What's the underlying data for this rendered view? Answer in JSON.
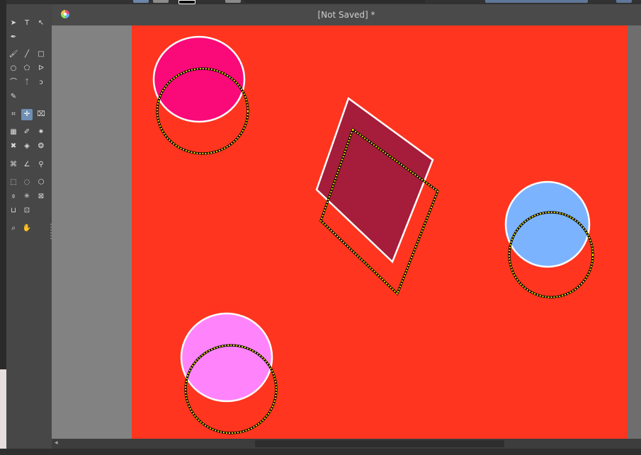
{
  "document": {
    "title": "[Not Saved]  *"
  },
  "colors": {
    "canvas_background": "#ff3520",
    "circle_top_left": "#fa0a78",
    "circle_right": "#7cb3ff",
    "circle_bottom_left": "#ff84fb",
    "diamond": "#a51d3a",
    "selection_marquee": "#ffee00",
    "active_tool": "#6f8fb3"
  },
  "toolbox": {
    "tools": [
      {
        "icon": "select-shapes-icon",
        "glyph": "➤"
      },
      {
        "icon": "text-tool-icon",
        "glyph": "T"
      },
      {
        "icon": "edit-shapes-icon",
        "glyph": "↖"
      },
      {
        "icon": "calligraphy-icon",
        "glyph": "✒"
      },
      {
        "icon": "freehand-brush-icon",
        "glyph": "🖌"
      },
      {
        "icon": "line-tool-icon",
        "glyph": "╱"
      },
      {
        "icon": "rectangle-tool-icon",
        "glyph": "□"
      },
      {
        "icon": "ellipse-tool-icon",
        "glyph": "○"
      },
      {
        "icon": "polygon-tool-icon",
        "glyph": "⬠"
      },
      {
        "icon": "polyline-tool-icon",
        "glyph": "ᐅ"
      },
      {
        "icon": "bezier-curve-icon",
        "glyph": "⌒"
      },
      {
        "icon": "dynamic-brush-icon",
        "glyph": "ᛏ"
      },
      {
        "icon": "freehand-path-icon",
        "glyph": "ↄ"
      },
      {
        "icon": "multibrush-icon",
        "glyph": "✎"
      },
      {
        "icon": "transform-tool-icon",
        "glyph": "⌗"
      },
      {
        "icon": "move-tool-icon",
        "glyph": "✛"
      },
      {
        "icon": "crop-tool-icon",
        "glyph": "⌧"
      },
      {
        "icon": "gradient-tool-icon",
        "glyph": "▦"
      },
      {
        "icon": "color-picker-icon",
        "glyph": "✐"
      },
      {
        "icon": "smart-patch-icon",
        "glyph": "✷"
      },
      {
        "icon": "colorize-mask-icon",
        "glyph": "✖"
      },
      {
        "icon": "fill-tool-icon",
        "glyph": "◈"
      },
      {
        "icon": "pattern-edit-icon",
        "glyph": "❂"
      },
      {
        "icon": "assistant-tool-icon",
        "glyph": "⌘"
      },
      {
        "icon": "measure-tool-icon",
        "glyph": "∠"
      },
      {
        "icon": "reference-pin-icon",
        "glyph": "⚲"
      },
      {
        "icon": "rectangular-selection-icon",
        "glyph": "⬚"
      },
      {
        "icon": "elliptical-selection-icon",
        "glyph": "◌"
      },
      {
        "icon": "polygonal-selection-icon",
        "glyph": "⬡"
      },
      {
        "icon": "freehand-selection-icon",
        "glyph": "⌽"
      },
      {
        "icon": "contiguous-selection-icon",
        "glyph": "✳"
      },
      {
        "icon": "similar-color-selection-icon",
        "glyph": "⊠"
      },
      {
        "icon": "bezier-selection-icon",
        "glyph": "⊔"
      },
      {
        "icon": "magnetic-selection-icon",
        "glyph": "⊡"
      },
      {
        "icon": "zoom-tool-icon",
        "glyph": "⌕"
      },
      {
        "icon": "pan-tool-icon",
        "glyph": "✋"
      }
    ]
  }
}
